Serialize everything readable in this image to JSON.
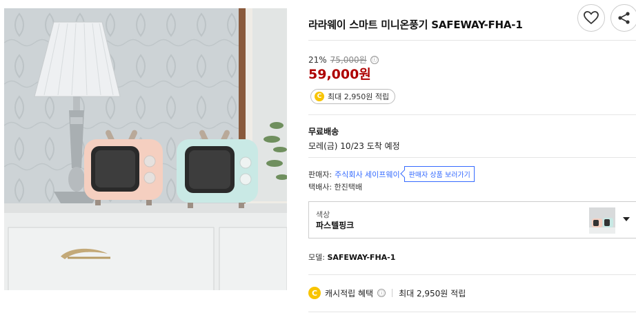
{
  "product": {
    "title": "라라웨이 스마트 미니온풍기 SAFEWAY-FHA-1",
    "image_label": "product-photo"
  },
  "price": {
    "discount_rate": "21%",
    "original_price": "75,000원",
    "sale_price": "59,000원",
    "info_icon": "ⓘ"
  },
  "reward": {
    "coin_symbol": "C",
    "label": "최대 2,950원 적립"
  },
  "shipping": {
    "title": "무료배송",
    "eta": "모레(금) 10/23 도착 예정"
  },
  "seller": {
    "label": "판매자:",
    "name": "주식회사 세이프웨이",
    "button_label": "판매자 상품 보러가기"
  },
  "courier": {
    "text": "택배사: 한진택배"
  },
  "option": {
    "label": "색상",
    "value": "파스텔핑크"
  },
  "model": {
    "label": "모델:",
    "value": "SAFEWAY-FHA-1"
  },
  "cash_benefit": {
    "label": "캐시적립 혜택",
    "info_icon": "ⓘ",
    "value": "최대 2,950원 적립"
  },
  "icons": {
    "heart": "heart-icon",
    "share": "share-icon",
    "coin": "coin-icon",
    "dropdown": "chevron-down-icon"
  },
  "colors": {
    "sale_price": "#ae0000",
    "link": "#346aff",
    "coin": "#f8c400"
  }
}
